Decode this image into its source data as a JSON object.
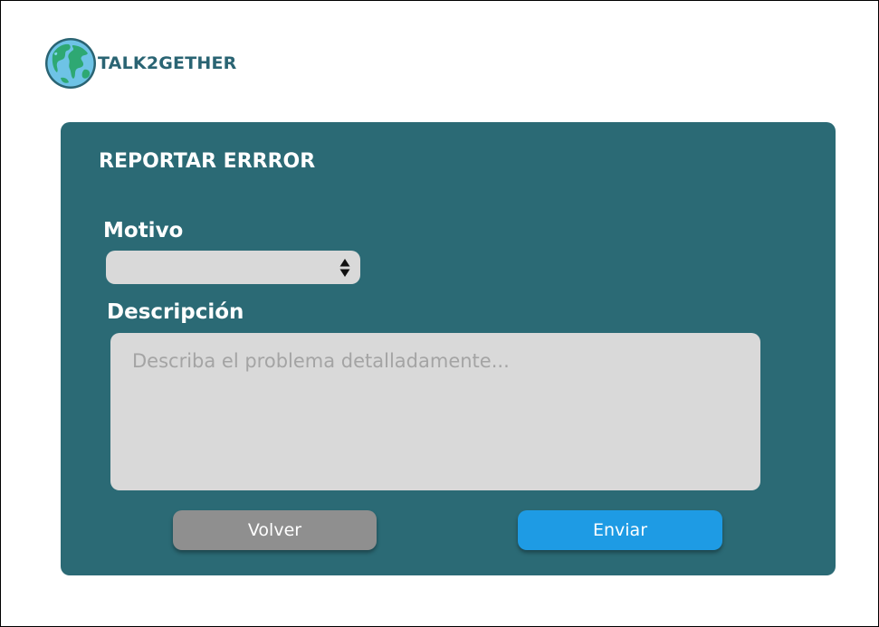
{
  "brand": {
    "name": "TALK2GETHER",
    "logo_icon": "globe-icon",
    "text_color": "#2a6473"
  },
  "card": {
    "title": "REPORTAR ERRROR",
    "background": "#2b6a75"
  },
  "form": {
    "motivo": {
      "label": "Motivo",
      "value": "",
      "icon": "select-arrows-icon"
    },
    "descripcion": {
      "label": "Descripción",
      "value": "",
      "placeholder": "Describa el problema detalladamente..."
    }
  },
  "actions": {
    "back_label": "Volver",
    "back_color": "#8f8f8f",
    "send_label": "Enviar",
    "send_color": "#1e9be4"
  }
}
